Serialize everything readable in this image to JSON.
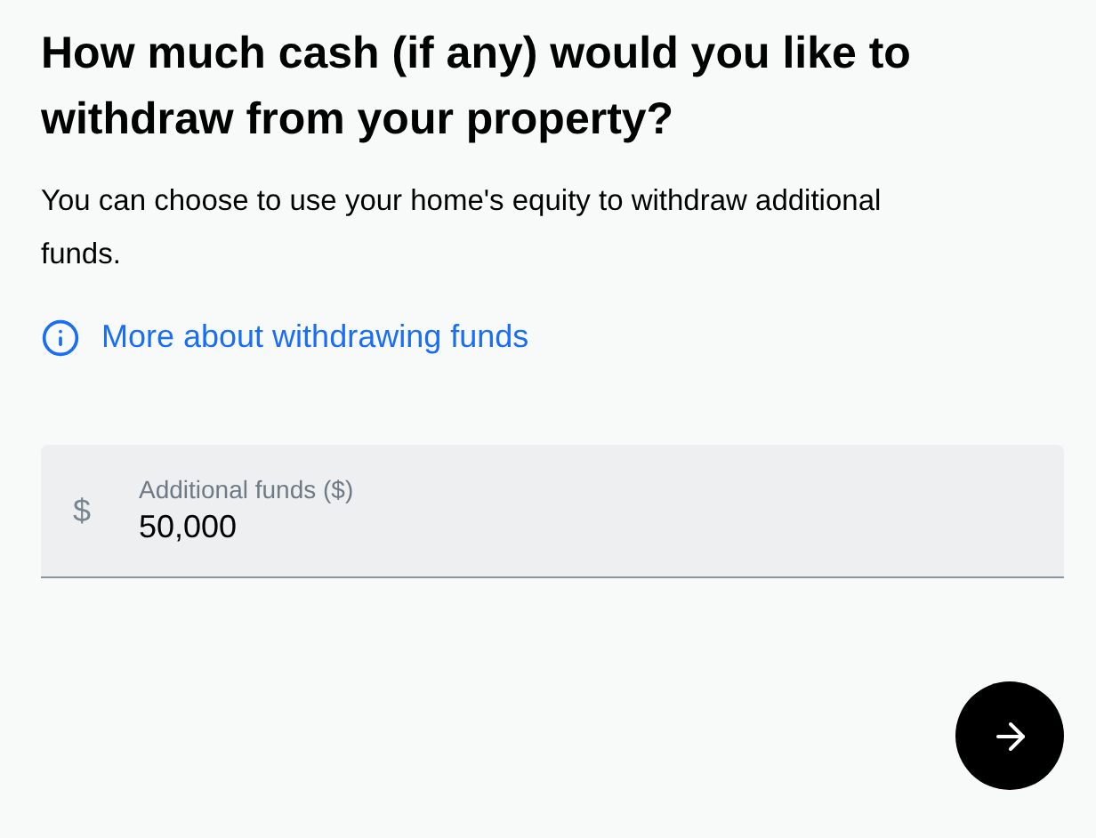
{
  "heading": "How much cash (if any) would you like to withdraw from your property?",
  "description": "You can choose to use your home's equity to withdraw additional funds.",
  "info_link": "More about withdrawing funds",
  "amount_field": {
    "prefix": "$",
    "label": "Additional funds ($)",
    "value": "50,000"
  },
  "next_button": {
    "kind": "arrow"
  }
}
